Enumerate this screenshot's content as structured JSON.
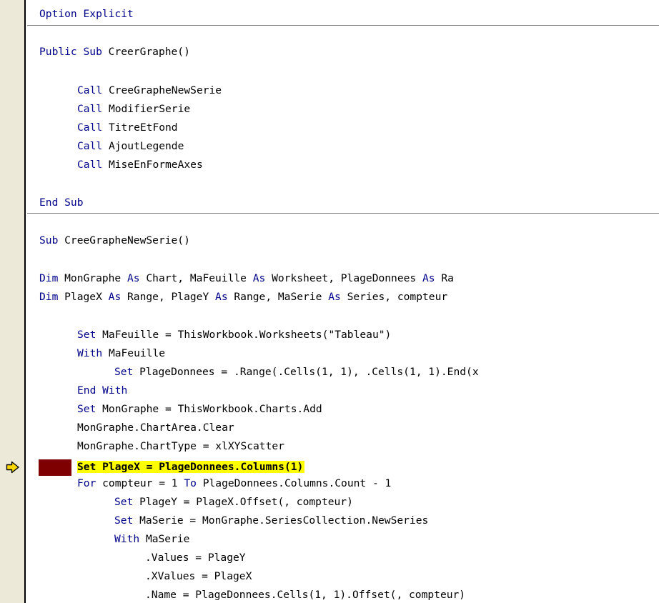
{
  "editor": {
    "line_0": {
      "kw1": "Option Explicit"
    },
    "line_1": {
      "kw1": "Public Sub",
      "rest": " CreerGraphe()"
    },
    "line_2": {
      "kw1": "Call",
      "rest": " CreeGrapheNewSerie"
    },
    "line_3": {
      "kw1": "Call",
      "rest": " ModifierSerie"
    },
    "line_4": {
      "kw1": "Call",
      "rest": " TitreEtFond"
    },
    "line_5": {
      "kw1": "Call",
      "rest": " AjoutLegende"
    },
    "line_6": {
      "kw1": "Call",
      "rest": " MiseEnFormeAxes"
    },
    "line_7": {
      "kw1": "End Sub"
    },
    "line_8": {
      "kw1": "Sub",
      "rest": " CreeGrapheNewSerie()"
    },
    "line_9": {
      "kw1": "Dim",
      "t1": " MonGraphe ",
      "kw2": "As",
      "t2": " Chart, MaFeuille ",
      "kw3": "As",
      "t3": " Worksheet, PlageDonnees ",
      "kw4": "As",
      "t4": " Ra"
    },
    "line_10": {
      "kw1": "Dim",
      "t1": " PlageX ",
      "kw2": "As",
      "t2": " Range, PlageY ",
      "kw3": "As",
      "t3": " Range, MaSerie ",
      "kw4": "As",
      "t4": " Series, compteur"
    },
    "line_11": {
      "kw1": "Set",
      "rest": " MaFeuille = ThisWorkbook.Worksheets(\"Tableau\")"
    },
    "line_12": {
      "kw1": "With",
      "rest": " MaFeuille"
    },
    "line_13": {
      "kw1": "Set",
      "rest": " PlageDonnees = .Range(.Cells(1, 1), .Cells(1, 1).End(x"
    },
    "line_14": {
      "kw1": "End With"
    },
    "line_15": {
      "kw1": "Set",
      "rest": " MonGraphe = ThisWorkbook.Charts.Add"
    },
    "line_16": {
      "rest": "MonGraphe.ChartArea.Clear"
    },
    "line_17": {
      "rest": "MonGraphe.ChartType = xlXYScatter"
    },
    "line_18": {
      "text": "Set PlageX = PlageDonnees.Columns(1)"
    },
    "line_19": {
      "kw1": "For",
      "t1": " compteur = 1 ",
      "kw2": "To",
      "t2": " PlageDonnees.Columns.Count - 1"
    },
    "line_20": {
      "kw1": "Set",
      "rest": " PlageY = PlageX.Offset(, compteur)"
    },
    "line_21": {
      "kw1": "Set",
      "rest": " MaSerie = MonGraphe.SeriesCollection.NewSeries"
    },
    "line_22": {
      "kw1": "With",
      "rest": " MaSerie"
    },
    "line_23": {
      "rest": ".Values = PlageY"
    },
    "line_24": {
      "rest": ".XValues = PlageX"
    },
    "line_25": {
      "rest": ".Name = PlageDonnees.Cells(1, 1).Offset(, compteur)"
    }
  },
  "colors": {
    "keyword": "#00008b",
    "text": "#000000",
    "current_line_highlight": "#ffff00",
    "breakpoint_bar": "#7f0000",
    "execution_arrow": "#ffd700",
    "margin": "#ece9d8"
  },
  "icons": {
    "execution_pointer": "current-statement-arrow-icon"
  }
}
